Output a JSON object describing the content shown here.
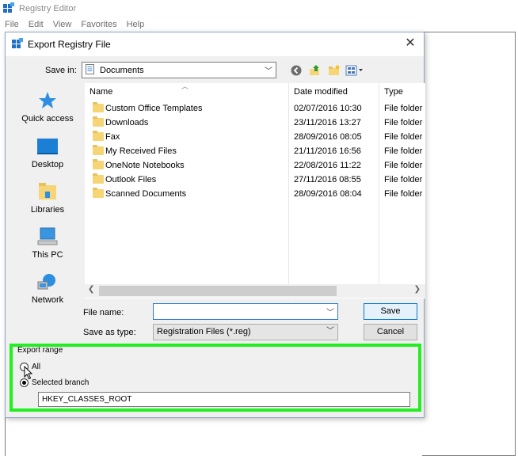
{
  "regedit": {
    "title": "Registry Editor",
    "menu": [
      "File",
      "Edit",
      "View",
      "Favorites",
      "Help"
    ]
  },
  "dialog": {
    "title": "Export Registry File",
    "close_glyph": "✕",
    "save_in_label": "Save in:",
    "save_in_value": "Documents",
    "places": [
      {
        "label": "Quick access",
        "icon": "star-icon"
      },
      {
        "label": "Desktop",
        "icon": "desktop-icon"
      },
      {
        "label": "Libraries",
        "icon": "libraries-icon"
      },
      {
        "label": "This PC",
        "icon": "computer-icon"
      },
      {
        "label": "Network",
        "icon": "network-icon"
      }
    ],
    "columns": {
      "name": "Name",
      "date": "Date modified",
      "type": "Type"
    },
    "files": [
      {
        "name": "Custom Office Templates",
        "date": "02/07/2016 10:30",
        "type": "File folder"
      },
      {
        "name": "Downloads",
        "date": "23/11/2016 13:27",
        "type": "File folder"
      },
      {
        "name": "Fax",
        "date": "28/09/2016 08:05",
        "type": "File folder"
      },
      {
        "name": "My Received Files",
        "date": "21/11/2016 16:56",
        "type": "File folder"
      },
      {
        "name": "OneNote Notebooks",
        "date": "22/08/2016 11:22",
        "type": "File folder"
      },
      {
        "name": "Outlook Files",
        "date": "27/11/2016 08:55",
        "type": "File folder"
      },
      {
        "name": "Scanned Documents",
        "date": "28/09/2016 08:04",
        "type": "File folder"
      }
    ],
    "file_name_label": "File name:",
    "file_name_value": "",
    "save_as_type_label": "Save as type:",
    "save_as_type_value": "Registration Files (*.reg)",
    "save_label": "Save",
    "cancel_label": "Cancel",
    "export_range": {
      "title": "Export range",
      "all_label": "All",
      "selected_label": "Selected branch",
      "selected": "Selected branch",
      "branch_value": "HKEY_CLASSES_ROOT"
    }
  },
  "colors": {
    "highlight": "#22ee22",
    "accent": "#0078d7",
    "folder": "#f5d576"
  }
}
